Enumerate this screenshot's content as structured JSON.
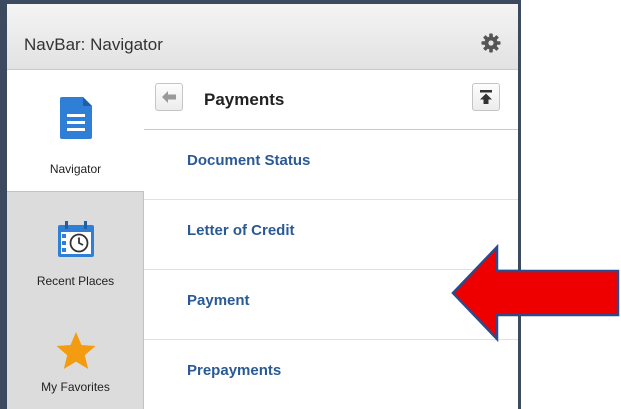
{
  "navbar": {
    "title": "NavBar: Navigator"
  },
  "sidebar": {
    "items": [
      {
        "label": "Navigator",
        "icon": "document-icon",
        "active": true
      },
      {
        "label": "Recent Places",
        "icon": "calendar-clock-icon",
        "active": false
      },
      {
        "label": "My Favorites",
        "icon": "star-icon",
        "active": false
      }
    ]
  },
  "content": {
    "title": "Payments",
    "items": [
      {
        "label": "Document Status"
      },
      {
        "label": "Letter of Credit"
      },
      {
        "label": "Payment"
      },
      {
        "label": "Prepayments"
      }
    ]
  },
  "colors": {
    "link": "#2a5a96",
    "accent_blue": "#2f7fd6",
    "arrow_red": "#ee0000",
    "arrow_outline": "#2e4a8a",
    "star": "#f39c12",
    "frame": "#3b4a5e"
  },
  "annotation": {
    "icon": "red-arrow-left"
  }
}
